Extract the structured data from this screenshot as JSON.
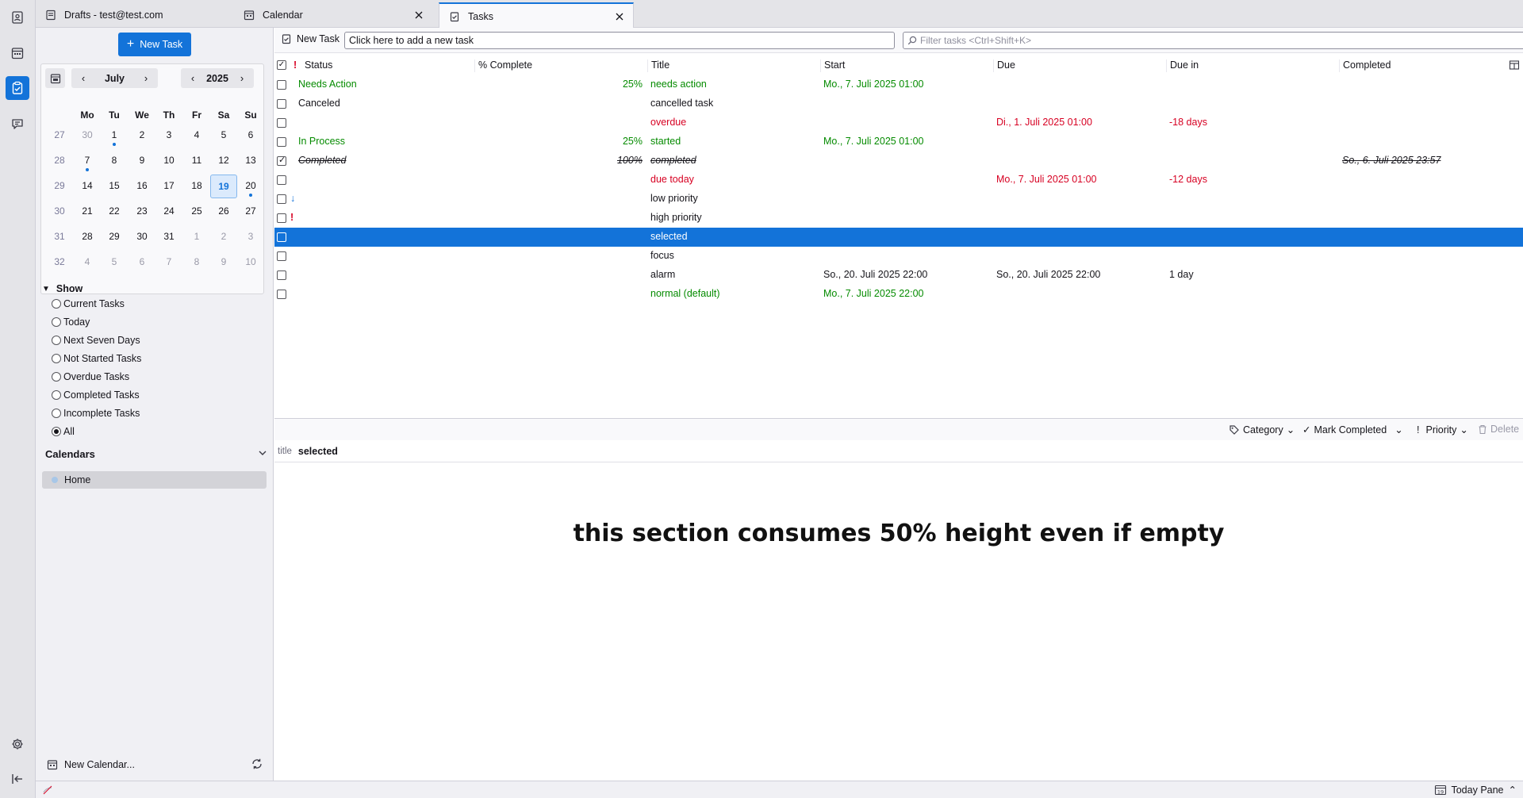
{
  "tabs": [
    {
      "label": "Drafts - test@test.com",
      "icon": "mail-icon"
    },
    {
      "label": "Calendar",
      "icon": "calendar-icon"
    },
    {
      "label": "Tasks",
      "icon": "tasks-icon",
      "selected": true
    }
  ],
  "sidebar": {
    "new_task_label": "New Task",
    "minimonth": {
      "month": "July",
      "year": "2025",
      "weekdays": [
        "Mo",
        "Tu",
        "We",
        "Th",
        "Fr",
        "Sa",
        "Su"
      ],
      "weeks": [
        {
          "week": "27",
          "days": [
            "30",
            "1",
            "2",
            "3",
            "4",
            "5",
            "6"
          ]
        },
        {
          "week": "28",
          "days": [
            "7",
            "8",
            "9",
            "10",
            "11",
            "12",
            "13"
          ]
        },
        {
          "week": "29",
          "days": [
            "14",
            "15",
            "16",
            "17",
            "18",
            "19",
            "20"
          ]
        },
        {
          "week": "30",
          "days": [
            "21",
            "22",
            "23",
            "24",
            "25",
            "26",
            "27"
          ]
        },
        {
          "week": "31",
          "days": [
            "28",
            "29",
            "30",
            "31",
            "1",
            "2",
            "3"
          ]
        },
        {
          "week": "32",
          "days": [
            "4",
            "5",
            "6",
            "7",
            "8",
            "9",
            "10"
          ]
        }
      ]
    },
    "show": {
      "header": "Show",
      "options": [
        "Current Tasks",
        "Today",
        "Next Seven Days",
        "Not Started Tasks",
        "Overdue Tasks",
        "Completed Tasks",
        "Incomplete Tasks",
        "All"
      ],
      "selected": "All"
    },
    "calendars_header": "Calendars",
    "calendars": [
      {
        "name": "Home",
        "color": "#a8c7e8"
      }
    ],
    "new_calendar_label": "New Calendar..."
  },
  "toolbar": {
    "new_task_label": "New Task",
    "quick_add_value": "Click here to add a new task",
    "filter_placeholder": "Filter tasks <Ctrl+Shift+K>"
  },
  "columns": [
    "Status",
    "% Complete",
    "Title",
    "Start",
    "Due",
    "Due in",
    "Completed"
  ],
  "tasks": [
    {
      "checked": false,
      "priority": "",
      "status": "Needs Action",
      "percent": "25%",
      "title": "needs action",
      "start": "Mo., 7. Juli 2025 01:00",
      "due": "",
      "due_in": "",
      "completed": "",
      "tone": "green"
    },
    {
      "checked": false,
      "priority": "",
      "status": "Canceled",
      "percent": "",
      "title": "cancelled task",
      "start": "",
      "due": "",
      "due_in": "",
      "completed": "",
      "tone": "normal"
    },
    {
      "checked": false,
      "priority": "",
      "status": "",
      "percent": "",
      "title": "overdue",
      "start": "",
      "due": "Di., 1. Juli 2025 01:00",
      "due_in": "-18 days",
      "completed": "",
      "tone": "red"
    },
    {
      "checked": false,
      "priority": "",
      "status": "In Process",
      "percent": "25%",
      "title": "started",
      "start": "Mo., 7. Juli 2025 01:00",
      "due": "",
      "due_in": "",
      "completed": "",
      "tone": "green"
    },
    {
      "checked": true,
      "priority": "",
      "status": "Completed",
      "percent": "100%",
      "title": "completed",
      "start": "",
      "due": "",
      "due_in": "",
      "completed": "So., 6. Juli 2025 23:57",
      "tone": "strike"
    },
    {
      "checked": false,
      "priority": "",
      "status": "",
      "percent": "",
      "title": "due today",
      "start": "",
      "due": "Mo., 7. Juli 2025 01:00",
      "due_in": "-12 days",
      "completed": "",
      "tone": "red"
    },
    {
      "checked": false,
      "priority": "↓",
      "status": "",
      "percent": "",
      "title": "low priority",
      "start": "",
      "due": "",
      "due_in": "",
      "completed": "",
      "tone": "normal"
    },
    {
      "checked": false,
      "priority": "!",
      "status": "",
      "percent": "",
      "title": "high priority",
      "start": "",
      "due": "",
      "due_in": "",
      "completed": "",
      "tone": "normal"
    },
    {
      "checked": false,
      "priority": "",
      "status": "",
      "percent": "",
      "title": "selected",
      "start": "",
      "due": "",
      "due_in": "",
      "completed": "",
      "tone": "selected"
    },
    {
      "checked": false,
      "priority": "",
      "status": "",
      "percent": "",
      "title": "focus",
      "start": "",
      "due": "",
      "due_in": "",
      "completed": "",
      "tone": "normal"
    },
    {
      "checked": false,
      "priority": "",
      "status": "",
      "percent": "",
      "title": "alarm",
      "start": "So., 20. Juli 2025 22:00",
      "due": "So., 20. Juli 2025 22:00",
      "due_in": "1 day",
      "completed": "",
      "tone": "normal"
    },
    {
      "checked": false,
      "priority": "",
      "status": "",
      "percent": "",
      "title": "normal (default)",
      "start": "Mo., 7. Juli 2025 22:00",
      "due": "",
      "due_in": "",
      "completed": "",
      "tone": "green"
    }
  ],
  "details": {
    "category_label": "Category",
    "mark_completed_label": "Mark Completed",
    "priority_label": "Priority",
    "delete_label": "Delete",
    "title_label": "title",
    "title_value": "selected",
    "empty_message": "this section consumes 50% height even if empty"
  },
  "statusbar": {
    "today_pane_label": "Today Pane",
    "today_pane_day": "19"
  },
  "colors": {
    "accent": "#1373d9",
    "green": "#058b00",
    "red": "#d70022"
  }
}
